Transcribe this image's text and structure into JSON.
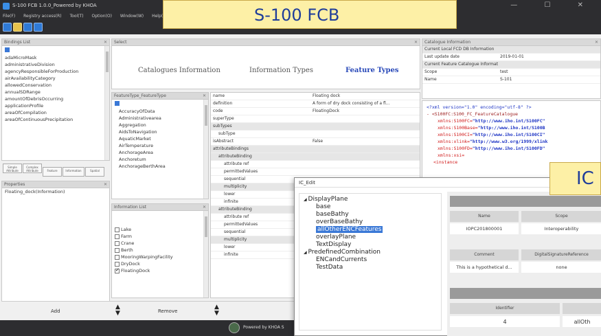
{
  "window": {
    "title": "S-100 FCB 1.0.0_Powered by KHOA",
    "controls": "— ☐ ✕",
    "menu": [
      "File(F)",
      "Registry access(R)",
      "Tool(T)",
      "Option(O)",
      "Window(W)",
      "Help(H)"
    ]
  },
  "banner_main": "S-100  FCB",
  "banner_ic": "IC",
  "left_panel": {
    "title": "Bindings List",
    "items": [
      "adaMicroMask",
      "administrativeDivision",
      "agencyResponsibleForProduction",
      "airAvailabilityCategory",
      "allowedConservation",
      "annualSDRange",
      "amountOfDebrisOccurring",
      "applicationProfile",
      "areaOfCompilation",
      "areaOfContinuousPrecipitation"
    ],
    "buttons": [
      "Simple Attribute",
      "Complex Attribute",
      "Feature",
      "Information",
      "Spatial"
    ]
  },
  "properties_panel": {
    "title": "Properties",
    "items": [
      "Floating_dock(Information)"
    ]
  },
  "center": {
    "tabs": [
      "Catalogues Information",
      "Information Types",
      "Feature Types"
    ],
    "header": "Select"
  },
  "feature_list": {
    "title": "FeatureType_FeatureType",
    "items": [
      "AccuracyOfData",
      "Administrativearea",
      "Aggregation",
      "AidsToNavigation",
      "AquaticMarket",
      "AirTemperature",
      "AnchorageArea",
      "Anchoretum",
      "AnchorageBerthArea"
    ]
  },
  "property_grid": [
    {
      "k": "name",
      "v": "Floating dock",
      "grp": false
    },
    {
      "k": "definition",
      "v": "A form of dry dock consisting of a fl...",
      "grp": false
    },
    {
      "k": "code",
      "v": "FloatingDock",
      "grp": false
    },
    {
      "k": "superType",
      "v": "",
      "grp": false
    },
    {
      "k": "subTypes",
      "v": "",
      "grp": true
    },
    {
      "k": "subType",
      "v": "",
      "grp": false
    },
    {
      "k": "isAbstract",
      "v": "False",
      "grp": false
    },
    {
      "k": "attributeBindings",
      "v": "",
      "grp": true
    },
    {
      "k": "attributeBinding",
      "v": "",
      "grp": true
    },
    {
      "k": "attribute ref",
      "v": "",
      "grp": false
    },
    {
      "k": "permittedValues",
      "v": "",
      "grp": false
    },
    {
      "k": "sequential",
      "v": "",
      "grp": false
    },
    {
      "k": "multiplicity",
      "v": "",
      "grp": true
    },
    {
      "k": "lower",
      "v": "",
      "grp": false
    },
    {
      "k": "infinite",
      "v": "",
      "grp": false
    },
    {
      "k": "attributeBinding",
      "v": "",
      "grp": true
    },
    {
      "k": "attribute ref",
      "v": "",
      "grp": false
    },
    {
      "k": "permittedValues",
      "v": "",
      "grp": false
    },
    {
      "k": "sequential",
      "v": "",
      "grp": false
    },
    {
      "k": "multiplicity",
      "v": "",
      "grp": true
    },
    {
      "k": "lower",
      "v": "",
      "grp": false
    },
    {
      "k": "infinite",
      "v": "",
      "grp": false
    }
  ],
  "checklist": {
    "title": "Information List",
    "items": [
      {
        "label": "Lake",
        "on": false
      },
      {
        "label": "Farm",
        "on": false
      },
      {
        "label": "Crane",
        "on": false
      },
      {
        "label": "Berth",
        "on": false
      },
      {
        "label": "MooringWarpingFacility",
        "on": false
      },
      {
        "label": "DryDock",
        "on": false
      },
      {
        "label": "FloatingDock",
        "on": true
      }
    ]
  },
  "bottom": {
    "add": "Add",
    "remove": "Remove",
    "footer": "Powered by KHOA S"
  },
  "right_info": {
    "title": "Catalogue Information",
    "rows": [
      {
        "k": "Current Local FCD DB Information",
        "v": "",
        "grp": true
      },
      {
        "k": "Last update date",
        "v": "2019-01-01",
        "grp": false
      },
      {
        "k": "Current Feature Catalogue Information",
        "v": "",
        "grp": true
      },
      {
        "k": "Scope",
        "v": "test",
        "grp": false
      },
      {
        "k": "Name",
        "v": "S-101",
        "grp": false
      }
    ]
  },
  "xml": {
    "l1": "<?xml version=\"1.0\" encoding=\"utf-8\" ?>",
    "l2": "- <S100FC:S100_FC_FeatureCatalogue",
    "a1": "xmlns:S100FC=",
    "v1": "\"http://www.iho.int/S100FC\"",
    "a2": "xmlns:S100Base=",
    "v2": "\"http://www.iho.int/S100B",
    "a3": "xmlns:S100CI=",
    "v3": "\"http://www.iho.int/S100CI\"",
    "a4": "xmlns:xlink=",
    "v4": "\"http://www.w3.org/1999/xlink",
    "a5": "xmlns:S100FD=",
    "v5": "\"http://www.iho.int/S100FD\"",
    "a6": "xmlns:xsi=",
    "l8": "<instance"
  },
  "ic": {
    "title": "IC_Edit",
    "tree": [
      {
        "label": "DisplayPlane",
        "lvl": 0,
        "sel": false
      },
      {
        "label": "base",
        "lvl": 1,
        "sel": false
      },
      {
        "label": "baseBathy",
        "lvl": 1,
        "sel": false
      },
      {
        "label": "overBaseBathy",
        "lvl": 1,
        "sel": false
      },
      {
        "label": "allOtherENCFeatures",
        "lvl": 1,
        "sel": true
      },
      {
        "label": "overlayPlane",
        "lvl": 1,
        "sel": false
      },
      {
        "label": "TextDisplay",
        "lvl": 1,
        "sel": false
      },
      {
        "label": "PredefinedCombination",
        "lvl": 0,
        "sel": false
      },
      {
        "label": "ENCandCurrents",
        "lvl": 1,
        "sel": false
      },
      {
        "label": "TestData",
        "lvl": 1,
        "sel": false
      }
    ],
    "table1": {
      "headers": [
        "Name",
        "Scope"
      ],
      "values": [
        "IOPC201800001",
        "Interoperability"
      ],
      "headers2": [
        "Comment",
        "DigitalSignatureReference"
      ],
      "values2": [
        "This is a hypothetical d...",
        "none"
      ]
    },
    "table2": {
      "headers": [
        "Identifier"
      ],
      "values": [
        "4",
        "allOth"
      ]
    }
  }
}
